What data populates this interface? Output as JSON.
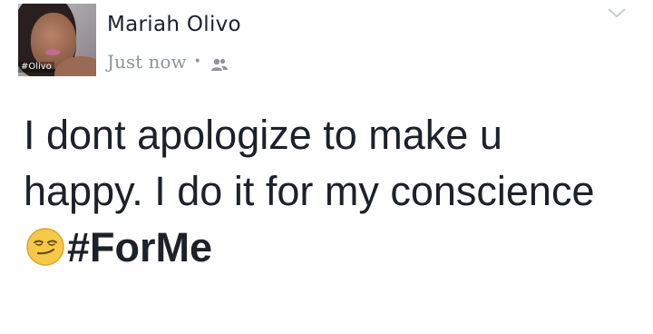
{
  "post": {
    "author_name": "Mariah Olivo",
    "avatar_tag": "#Olivo",
    "timestamp": "Just now",
    "separator": "•",
    "audience_icon": "friends-icon",
    "menu_icon": "chevron-down-icon",
    "text_part1": "I dont apologize to make u happy. I do it for my conscience ",
    "emoji": "smirking-face-emoji",
    "hashtag": "#ForMe"
  },
  "colors": {
    "text": "#1d2129",
    "meta": "#90949c",
    "background": "#ffffff"
  }
}
